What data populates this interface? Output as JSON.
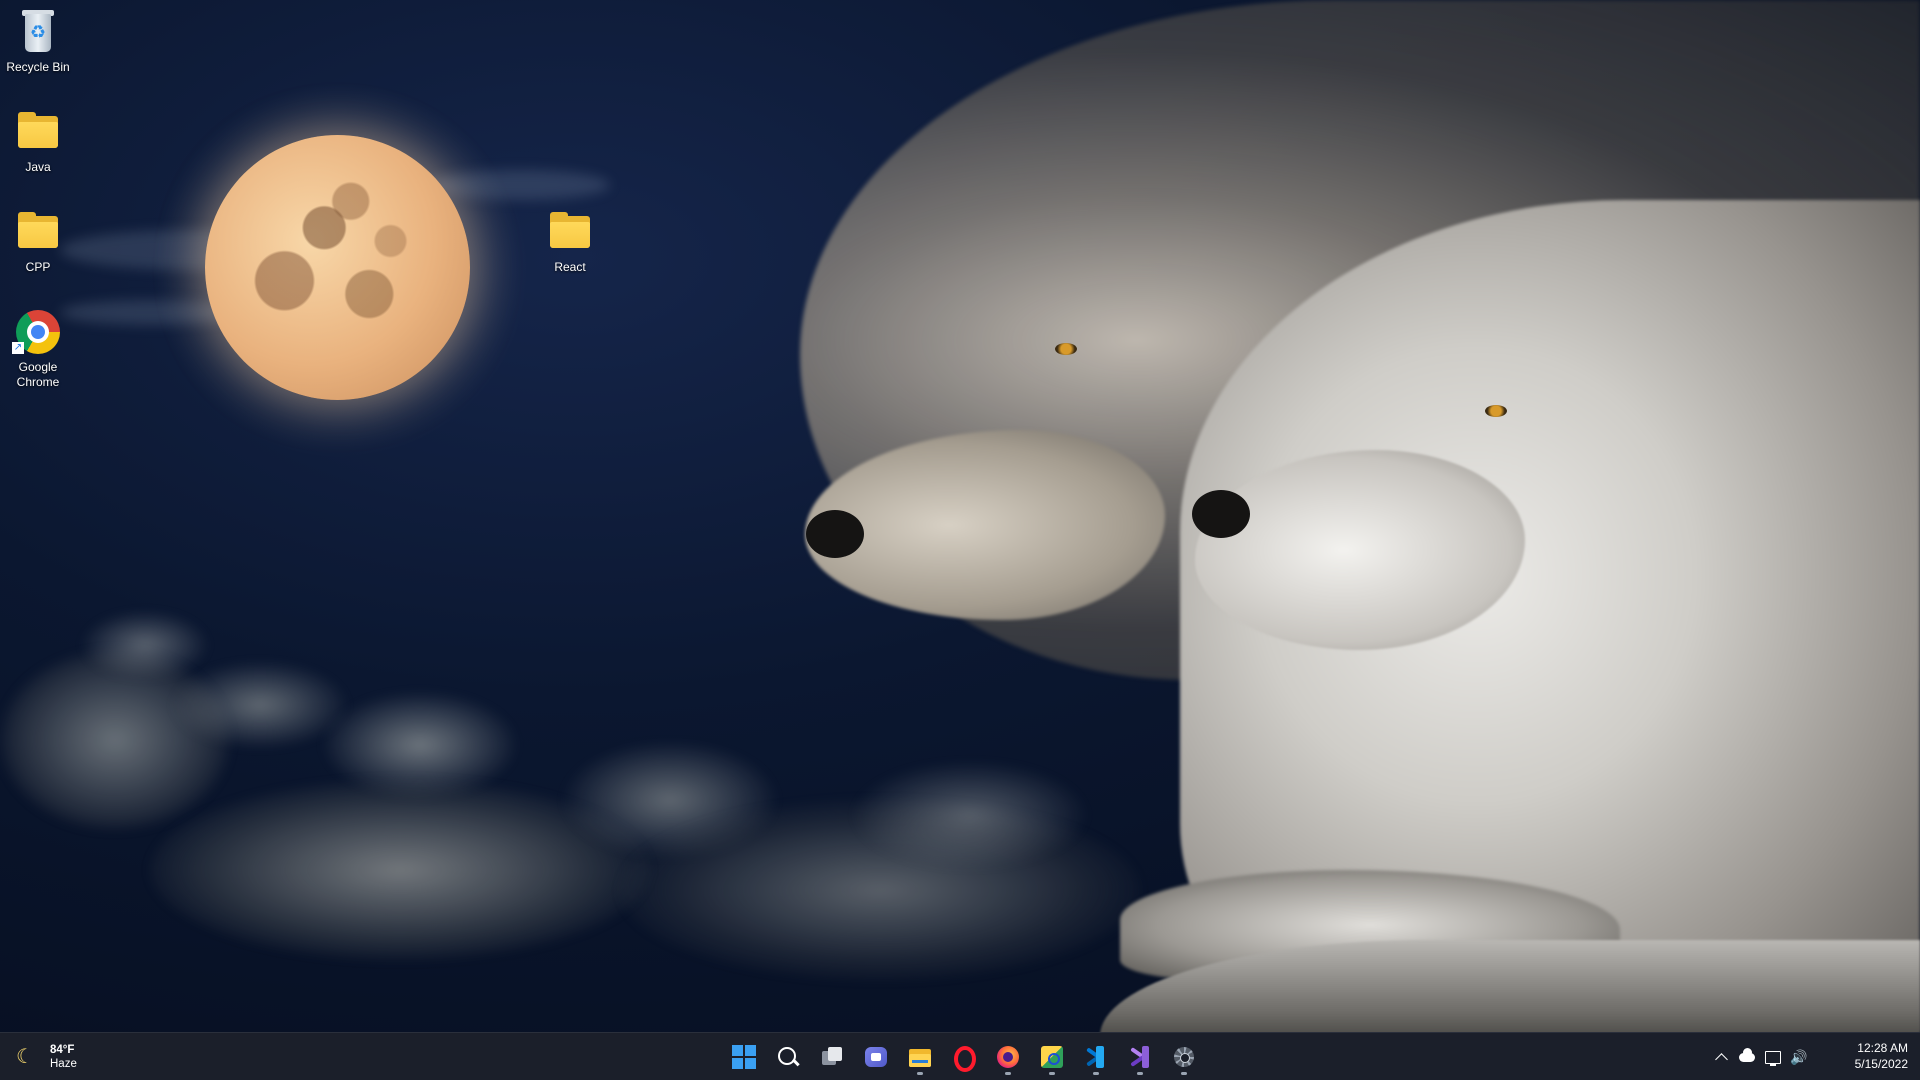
{
  "desktop": {
    "icons": [
      {
        "label": "Recycle Bin",
        "icon": "recycle-bin-icon"
      },
      {
        "label": "Java",
        "icon": "folder-icon"
      },
      {
        "label": "CPP",
        "icon": "folder-icon"
      },
      {
        "label": "Google Chrome",
        "icon": "chrome-icon"
      },
      {
        "label": "React",
        "icon": "folder-icon"
      }
    ]
  },
  "taskbar": {
    "weather": {
      "temperature": "84°F",
      "condition": "Haze",
      "icon": "moon-icon"
    },
    "apps": [
      {
        "name": "Start",
        "icon": "windows-start-icon",
        "running": false
      },
      {
        "name": "Search",
        "icon": "search-icon",
        "running": false
      },
      {
        "name": "Task View",
        "icon": "task-view-icon",
        "running": false
      },
      {
        "name": "Chat",
        "icon": "teams-chat-icon",
        "running": false
      },
      {
        "name": "File Explorer",
        "icon": "file-explorer-icon",
        "running": true
      },
      {
        "name": "Opera",
        "icon": "opera-icon",
        "running": false
      },
      {
        "name": "Firefox",
        "icon": "firefox-icon",
        "running": true
      },
      {
        "name": "Snip & Sketch",
        "icon": "snip-icon",
        "running": true
      },
      {
        "name": "Visual Studio Code",
        "icon": "vscode-icon",
        "running": true
      },
      {
        "name": "Visual Studio",
        "icon": "visual-studio-icon",
        "running": true
      },
      {
        "name": "Settings",
        "icon": "settings-gear-icon",
        "running": true
      }
    ],
    "tray": {
      "icons": [
        "chevron-up-icon",
        "onedrive-cloud-icon",
        "network-icon",
        "volume-icon"
      ]
    },
    "clock": {
      "time": "12:28 AM",
      "date": "5/15/2022"
    }
  },
  "colors": {
    "taskbar_bg": "#1b1f2a",
    "folder_yellow": "#ffd95a",
    "start_blue": "#3aa0f3"
  }
}
